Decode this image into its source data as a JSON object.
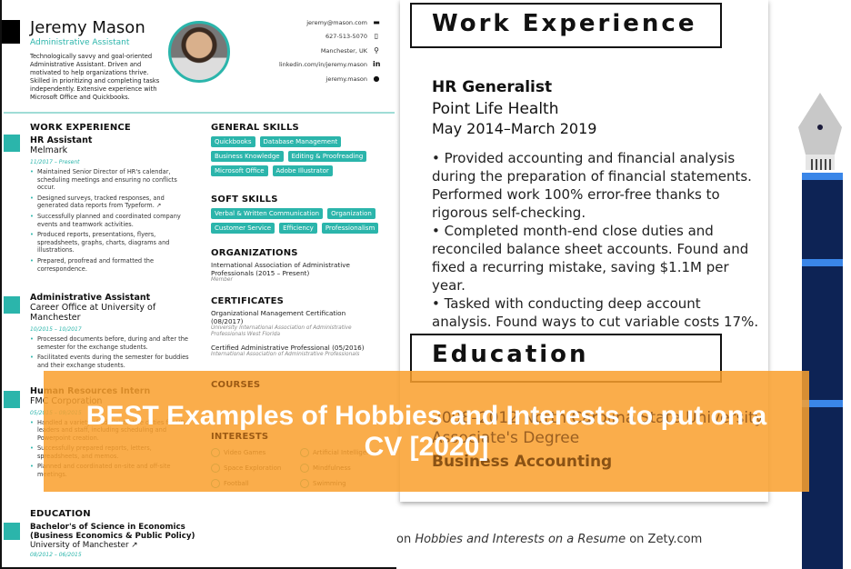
{
  "resume": {
    "name": "Jeremy Mason",
    "title": "Administrative Assistant",
    "summary": "Technologically savvy and goal-oriented Administrative Assistant. Driven and motivated to help organizations thrive. Skilled in prioritizing and completing tasks independently. Extensive experience with Microsoft Office and Quickbooks.",
    "contacts": [
      {
        "text": "jeremy@mason.com",
        "icon": "email-icon",
        "glyph": "▬"
      },
      {
        "text": "627-513-5070",
        "icon": "phone-icon",
        "glyph": "▯"
      },
      {
        "text": "Manchester, UK",
        "icon": "location-pin-icon",
        "glyph": "⚲"
      },
      {
        "text": "linkedin.com/in/jeremy.mason",
        "icon": "linkedin-icon",
        "glyph": "in"
      },
      {
        "text": "jeremy.mason",
        "icon": "skype-icon",
        "glyph": "●"
      }
    ],
    "work_heading": "WORK EXPERIENCE",
    "jobs": [
      {
        "title": "HR Assistant",
        "company": "Melmark",
        "dates": "11/2017 – Present",
        "bullets": [
          "Maintained Senior Director of HR's calendar, scheduling meetings and ensuring no conflicts occur.",
          "Designed surveys, tracked responses, and generated data reports from Typeform. ↗",
          "Successfully planned and coordinated company events and teamwork activities.",
          "Produced reports, presentations, flyers, spreadsheets, graphs, charts, diagrams and illustrations.",
          "Prepared, proofread and formatted the correspondence."
        ]
      },
      {
        "title": "Administrative Assistant",
        "company": "Career Office at University of Manchester",
        "dates": "10/2015 – 10/2017",
        "bullets": [
          "Processed documents before, during and after the semester for the exchange students.",
          "Facilitated events during the semester for buddies and their exchange students."
        ]
      },
      {
        "title": "Human Resources Intern",
        "company": "FMC Corporation",
        "dates": "05/2015 – 09/2015",
        "bullets": [
          "Handled a variety of administrative duties for HR leaders and staff, including scheduling and Powerpoint creation.",
          "Successfully prepared reports, letters, spreadsheets, and memos.",
          "Planned and coordinated on-site and off-site meetings."
        ]
      }
    ],
    "education_heading": "EDUCATION",
    "education": {
      "degree": "Bachelor's of Science in Economics (Business Economics & Public Policy)",
      "school": "University of Manchester ↗",
      "dates": "08/2012 – 06/2015"
    },
    "general_skills_heading": "GENERAL SKILLS",
    "general_skills": [
      "Quickbooks",
      "Database Management",
      "Business Knowledge",
      "Editing & Proofreading",
      "Microsoft Office",
      "Adobe Illustrator"
    ],
    "soft_skills_heading": "SOFT SKILLS",
    "soft_skills": [
      "Verbal & Written Communication",
      "Organization",
      "Customer Service",
      "Efficiency",
      "Professionalism"
    ],
    "organizations_heading": "ORGANIZATIONS",
    "organization": {
      "name": "International Association of Administrative Professionals (2015 – Present)",
      "role": "Member"
    },
    "certificates_heading": "CERTIFICATES",
    "certificates": [
      {
        "name": "Organizational Management Certification (08/2017)",
        "issuer": "University International Association of Administrative Professionals West Florida"
      },
      {
        "name": "Certified Administrative Professional (05/2016)",
        "issuer": "International Association of Administrative Professionals"
      }
    ],
    "courses_heading": "COURSES",
    "interests_heading": "INTERESTS",
    "interests": [
      {
        "label": "Video Games",
        "icon": "gamepad-icon"
      },
      {
        "label": "Artificial Intelligence",
        "icon": "ai-chip-icon"
      },
      {
        "label": "Space Exploration",
        "icon": "rocket-icon"
      },
      {
        "label": "Mindfulness",
        "icon": "meditation-icon"
      },
      {
        "label": "Football",
        "icon": "football-icon"
      },
      {
        "label": "Swimming",
        "icon": "swimming-icon"
      }
    ],
    "accent": "#2bb5ab"
  },
  "example": {
    "work_heading": "Work Experience",
    "job_title": "HR Generalist",
    "company": "Point Life Health",
    "dates": "May 2014–March 2019",
    "bullets": "• Provided accounting and financial analysis during the preparation of financial statements. Performed work 100% error-free thanks to rigorous self-checking.\n• Completed month-end close duties and reconciled balance sheet accounts. Found and fixed a recurring mistake, saving $1.1M per year.\n• Tasked with conducting deep account analysis. Found ways to cut variable costs 17%.",
    "education_heading": "Education",
    "edu_line1": "2008–2012 North Carolina State University",
    "edu_line2": "Associate's Degree",
    "edu_line3": "Business Accounting",
    "caption_pre": "on ",
    "caption_em": "Hobbies and Interests on a Resume",
    "caption_post": " on Zety.com"
  },
  "banner": {
    "line1": "BEST Examples of Hobbies and Interests to put on a",
    "line2": "CV [2020]",
    "color": "#f9a02d"
  }
}
